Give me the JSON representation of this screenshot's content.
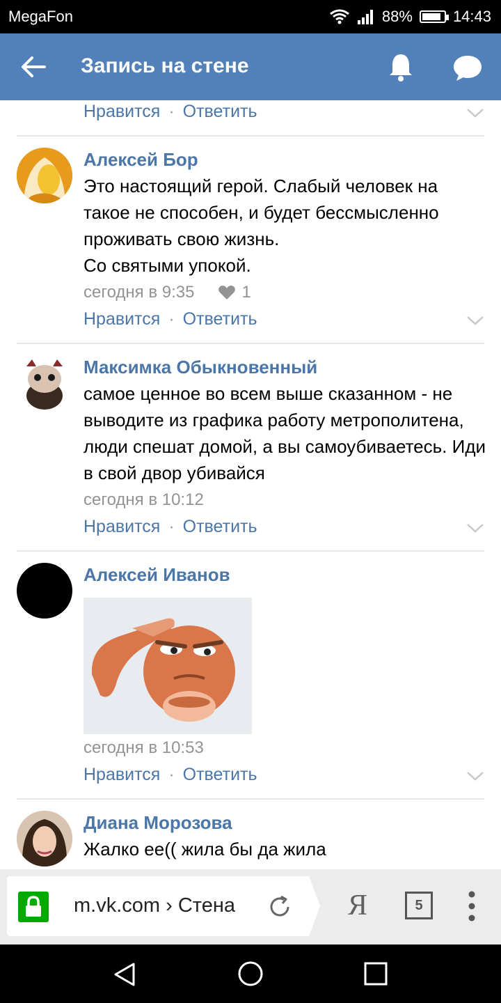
{
  "status_bar": {
    "carrier": "MegaFon",
    "battery": "88%",
    "time": "14:43"
  },
  "header": {
    "title": "Запись на стене"
  },
  "actions": {
    "like": "Нравится",
    "separator": "·",
    "reply": "Ответить"
  },
  "comments": [
    {
      "author": "Алексей Бор",
      "text": "Это настоящий герой. Слабый человек на такое не способен, и будет бессмысленно проживать свою жизнь.",
      "text2": "Со святыми упокой.",
      "time": "сегодня в 9:35",
      "likes": "1"
    },
    {
      "author": "Максимка Обыкновенный",
      "text": "самое ценное во всем выше сказанном - не выводите из графика работу метрополитена, люди спешат домой, а вы самоубиваетесь. Иди в свой двор убивайся",
      "time": "сегодня в 10:12"
    },
    {
      "author": "Алексей Иванов",
      "time": "сегодня в 10:53"
    },
    {
      "author": "Диана Морозова",
      "text": "Жалко ее(( жила бы да жила"
    }
  ],
  "browser": {
    "url": "m.vk.com › Стена",
    "yandex": "Я",
    "tab_count": "5"
  },
  "colors": {
    "header": "#5181b8",
    "link": "#4a76a8",
    "meta": "#939393",
    "lock": "#00aa00"
  }
}
